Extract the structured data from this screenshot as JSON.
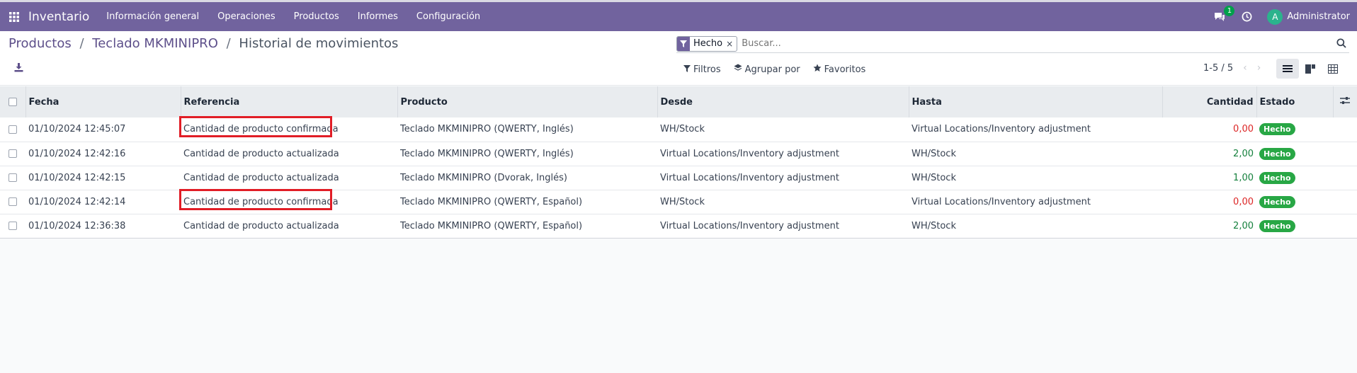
{
  "topbar": {
    "app_name": "Inventario",
    "menu": [
      "Información general",
      "Operaciones",
      "Productos",
      "Informes",
      "Configuración"
    ],
    "chat_badge": "1",
    "avatar_initial": "A",
    "user_name": "Administrator",
    "bg_color": "#71639e"
  },
  "breadcrumb": {
    "items": [
      "Productos",
      "Teclado MKMINIPRO"
    ],
    "separator": "/",
    "current": "Historial de movimientos"
  },
  "search": {
    "facet_label": "Hecho",
    "facet_remove": "×",
    "placeholder": "Buscar..."
  },
  "filters": {
    "filters_label": "Filtros",
    "group_by_label": "Agrupar por",
    "favorites_label": "Favoritos"
  },
  "pager": {
    "value": "1-5 / 5",
    "prev": "‹",
    "next": "›"
  },
  "table": {
    "columns": {
      "fecha": "Fecha",
      "referencia": "Referencia",
      "producto": "Producto",
      "desde": "Desde",
      "hasta": "Hasta",
      "cantidad": "Cantidad",
      "estado": "Estado"
    },
    "rows": [
      {
        "fecha": "01/10/2024 12:45:07",
        "referencia": "Cantidad de producto confirmada",
        "producto": "Teclado MKMINIPRO (QWERTY, Inglés)",
        "desde": "WH/Stock",
        "hasta": "Virtual Locations/Inventory adjustment",
        "cantidad": "0,00",
        "estado": "Hecho",
        "highlight": true,
        "qty_color": "red"
      },
      {
        "fecha": "01/10/2024 12:42:16",
        "referencia": "Cantidad de producto actualizada",
        "producto": "Teclado MKMINIPRO (QWERTY, Inglés)",
        "desde": "Virtual Locations/Inventory adjustment",
        "hasta": "WH/Stock",
        "cantidad": "2,00",
        "estado": "Hecho",
        "highlight": false,
        "qty_color": "green"
      },
      {
        "fecha": "01/10/2024 12:42:15",
        "referencia": "Cantidad de producto actualizada",
        "producto": "Teclado MKMINIPRO (Dvorak, Inglés)",
        "desde": "Virtual Locations/Inventory adjustment",
        "hasta": "WH/Stock",
        "cantidad": "1,00",
        "estado": "Hecho",
        "highlight": false,
        "qty_color": "green"
      },
      {
        "fecha": "01/10/2024 12:42:14",
        "referencia": "Cantidad de producto confirmada",
        "producto": "Teclado MKMINIPRO (QWERTY, Español)",
        "desde": "WH/Stock",
        "hasta": "Virtual Locations/Inventory adjustment",
        "cantidad": "0,00",
        "estado": "Hecho",
        "highlight": true,
        "qty_color": "red"
      },
      {
        "fecha": "01/10/2024 12:36:38",
        "referencia": "Cantidad de producto actualizada",
        "producto": "Teclado MKMINIPRO (QWERTY, Español)",
        "desde": "Virtual Locations/Inventory adjustment",
        "hasta": "WH/Stock",
        "cantidad": "2,00",
        "estado": "Hecho",
        "highlight": false,
        "qty_color": "green"
      }
    ]
  }
}
